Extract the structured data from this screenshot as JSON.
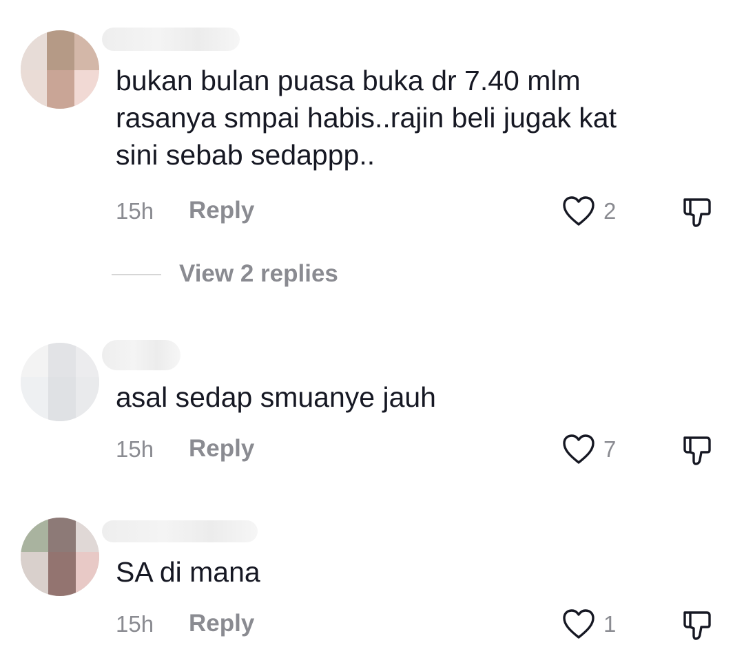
{
  "comments": [
    {
      "text": "bukan bulan puasa buka dr 7.40 mlm\nrasanya smpai habis..rajin beli jugak kat\nsini sebab sedappp..",
      "time": "15h",
      "reply_label": "Reply",
      "likes": "2",
      "view_replies_label": "View 2 replies",
      "like_icon": "heart-outline-icon",
      "dislike_icon": "thumbs-down-icon"
    },
    {
      "text": "asal sedap smuanye jauh",
      "time": "15h",
      "reply_label": "Reply",
      "likes": "7",
      "like_icon": "heart-outline-icon",
      "dislike_icon": "thumbs-down-icon"
    },
    {
      "text": "SA di mana",
      "time": "15h",
      "reply_label": "Reply",
      "likes": "1",
      "like_icon": "heart-outline-icon",
      "dislike_icon": "thumbs-down-icon"
    }
  ],
  "colors": {
    "text": "#161823",
    "secondary": "#8a8b91",
    "divider": "#d6d6d6"
  }
}
